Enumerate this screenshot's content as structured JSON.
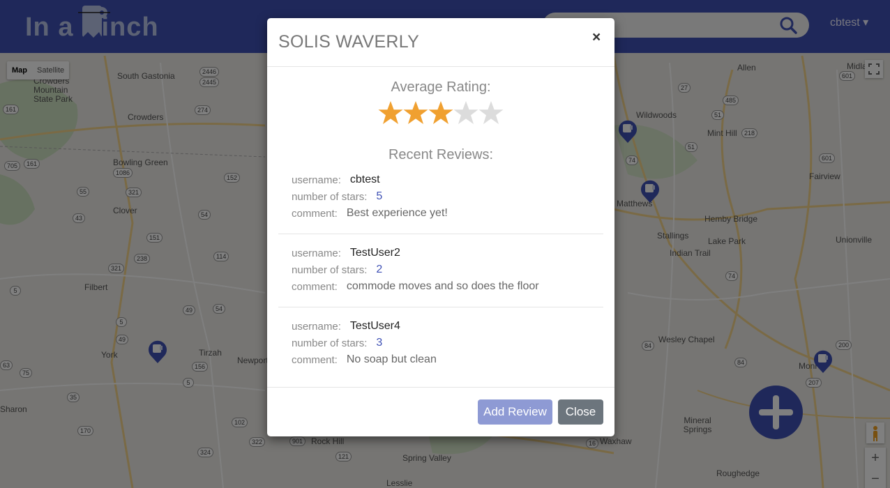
{
  "header": {
    "logo_left": "In a",
    "logo_right": "inch",
    "user": "cbtest ▾"
  },
  "map": {
    "type_options": [
      "Map",
      "Satellite"
    ],
    "places": [
      "South Gastonia",
      "Crowders Mountain State Park",
      "Crowders",
      "Bowling Green",
      "Clover",
      "Filbert",
      "York",
      "Tirzah",
      "Newport",
      "Rock Hill",
      "Spring Valley",
      "Lesslie",
      "Allen",
      "Wildwoods",
      "Mint Hill",
      "Matthews",
      "Hemby Bridge",
      "Stallings",
      "Indian Trail",
      "Lake Park",
      "Fairview",
      "Unionville",
      "Wesley Chapel",
      "Waxhaw",
      "Mineral Springs",
      "Roughedge",
      "Monroe",
      "Sharon",
      "Midland"
    ],
    "highway_shields": [
      "2446",
      "2445",
      "274",
      "161",
      "705",
      "161",
      "1086",
      "321",
      "152",
      "55",
      "43",
      "54",
      "151",
      "238",
      "114",
      "321",
      "5",
      "49",
      "54",
      "5",
      "49",
      "156",
      "5",
      "35",
      "170",
      "102",
      "324",
      "322",
      "901",
      "121",
      "27",
      "51",
      "218",
      "74",
      "601",
      "51",
      "485",
      "74",
      "84",
      "200",
      "207",
      "84",
      "16",
      "601",
      "75",
      "63"
    ],
    "zoom_in": "+",
    "zoom_out": "−"
  },
  "modal": {
    "title": "SOLIS WAVERLY",
    "close_x": "×",
    "average_label": "Average Rating:",
    "average_rating": 3,
    "max_rating": 5,
    "recent_label": "Recent Reviews:",
    "field_labels": {
      "username": "username:",
      "stars": "number of stars:",
      "comment": "comment:"
    },
    "reviews": [
      {
        "username": "cbtest",
        "stars": "5",
        "comment": "Best experience yet!"
      },
      {
        "username": "TestUser2",
        "stars": "2",
        "comment": "commode moves and so does the floor"
      },
      {
        "username": "TestUser4",
        "stars": "3",
        "comment": "No soap but clean"
      }
    ],
    "add_review_label": "Add Review",
    "close_label": "Close"
  },
  "colors": {
    "brand": "#3f51b5",
    "star_filled": "#f0a030",
    "star_empty": "#dcdcdc"
  }
}
